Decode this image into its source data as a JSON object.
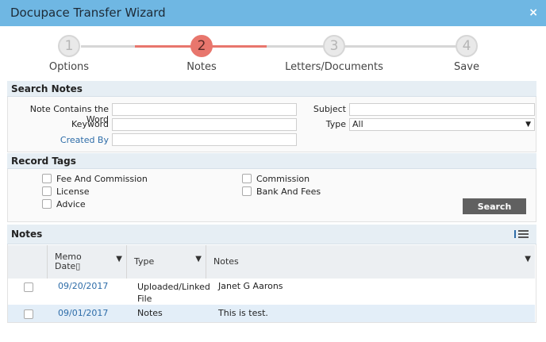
{
  "window": {
    "title": "Docupace Transfer Wizard",
    "close_glyph": "×"
  },
  "wizard": {
    "steps": [
      {
        "num": "1",
        "label": "Options"
      },
      {
        "num": "2",
        "label": "Notes"
      },
      {
        "num": "3",
        "label": "Letters/Documents"
      },
      {
        "num": "4",
        "label": "Save"
      }
    ],
    "active_step": 2
  },
  "search_notes": {
    "header": "Search Notes",
    "note_contains_label": "Note Contains the Word",
    "note_contains_value": "",
    "keyword_label": "Keyword",
    "keyword_value": "",
    "created_by_label": "Created By",
    "created_by_value": "",
    "subject_label": "Subject",
    "subject_value": "",
    "type_label": "Type",
    "type_value": "All"
  },
  "record_tags": {
    "header": "Record Tags",
    "tags": [
      {
        "label": "Fee And Commission",
        "checked": false
      },
      {
        "label": "License",
        "checked": false
      },
      {
        "label": "Advice",
        "checked": false
      },
      {
        "label": "Commission",
        "checked": false
      },
      {
        "label": "Bank And Fees",
        "checked": false
      }
    ],
    "search_label": "Search"
  },
  "notes": {
    "header": "Notes",
    "columns": {
      "memo_date_line1": "Memo",
      "memo_date_line2": "Date▯",
      "type": "Type",
      "notes": "Notes"
    },
    "rows": [
      {
        "date": "09/20/2017",
        "type_line1": "Uploaded/Linked",
        "type_line2": "File",
        "notes": "Janet G Aarons"
      },
      {
        "date": "09/01/2017",
        "type_line1": "Notes",
        "type_line2": "",
        "notes": "This is test."
      }
    ]
  },
  "colors": {
    "title_bar": "#6fb7e3",
    "active_step": "#e8766d",
    "section_header": "#e6eef4",
    "link": "#2d6ca8",
    "search_button": "#606060",
    "selected_row": "#e3eef8"
  }
}
